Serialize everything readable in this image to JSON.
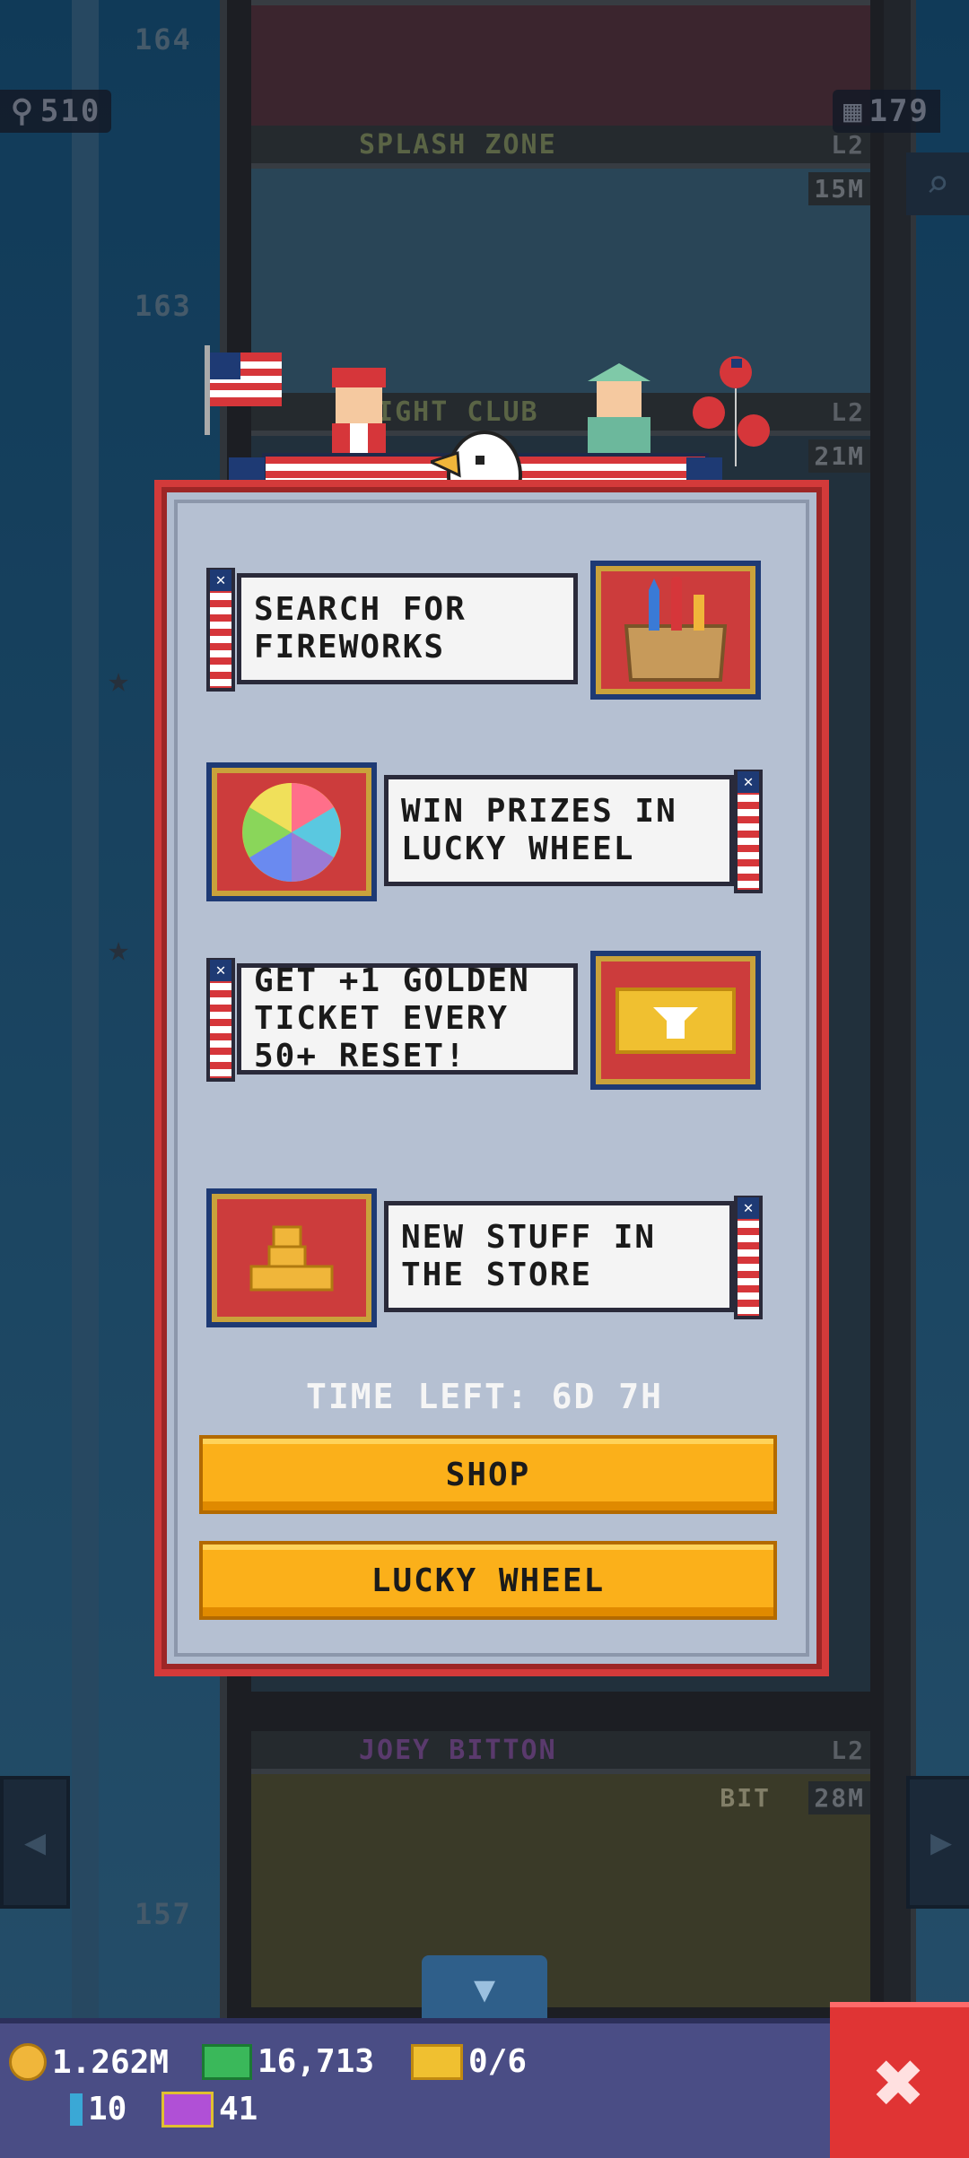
{
  "hud": {
    "population": "510",
    "floors": "179",
    "population_icon": "person-icon",
    "floors_icon": "building-icon",
    "search_icon": "magnifier-icon"
  },
  "tower": {
    "floor_numbers": [
      "164",
      "163",
      "157"
    ],
    "floors": [
      {
        "name": "SPLASH ZONE",
        "level": "L2",
        "earnings": "15M"
      },
      {
        "name": "NIGHT CLUB",
        "level": "L2",
        "earnings": "21M"
      },
      {
        "name": "JOEY BITTON",
        "level": "L2",
        "earnings": "28M",
        "sign": "BIT"
      }
    ],
    "partial_earnings": [
      "L2",
      "L2",
      "L2",
      "L2",
      "L2"
    ]
  },
  "event": {
    "rows": [
      {
        "label": "SEARCH FOR\nFIREWORKS",
        "icon": "fireworks-box-icon",
        "icon_side": "right"
      },
      {
        "label": "WIN PRIZES IN\nLUCKY WHEEL",
        "icon": "lucky-wheel-icon",
        "icon_side": "left"
      },
      {
        "label": "GET +1 GOLDEN\nTICKET EVERY\n50+ RESET!",
        "icon": "golden-ticket-icon",
        "icon_side": "right"
      },
      {
        "label": "NEW STUFF IN\nTHE STORE",
        "icon": "gold-coins-icon",
        "icon_side": "left"
      }
    ],
    "time_left": "TIME LEFT: 6D 7H",
    "shop_label": "SHOP",
    "lucky_wheel_label": "LUCKY WHEEL"
  },
  "currency": {
    "coins": "1.262M",
    "bux": "16,713",
    "tickets": "0/6",
    "keys": "10",
    "vip": "41"
  },
  "colors": {
    "accent_red": "#d33a3a",
    "button_orange": "#fbb01a",
    "navy": "#1e3a74",
    "bar": "#4a4d85"
  }
}
